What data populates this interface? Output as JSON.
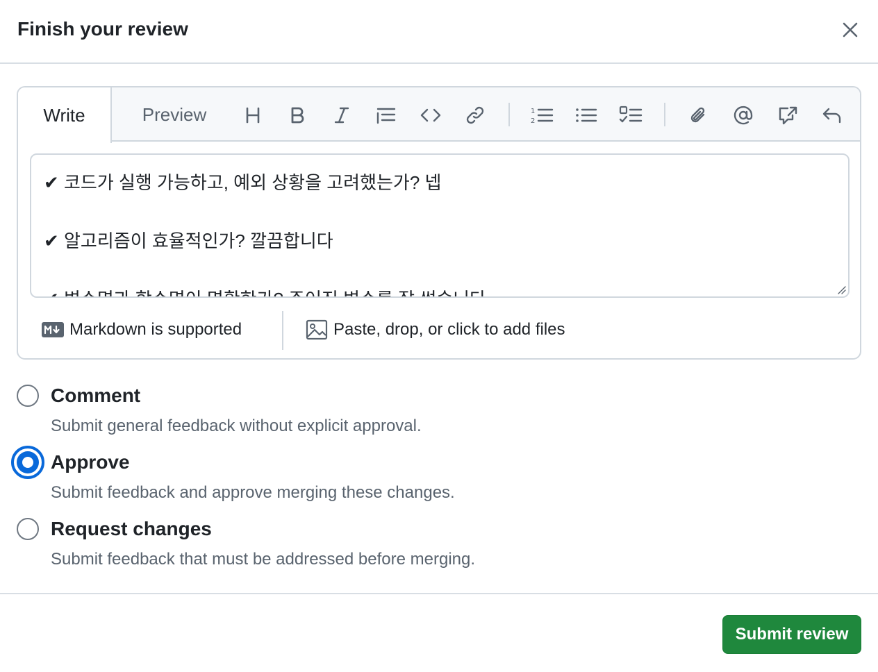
{
  "dialog": {
    "title": "Finish your review"
  },
  "editor": {
    "tabs": [
      {
        "label": "Write",
        "active": true
      },
      {
        "label": "Preview",
        "active": false
      }
    ],
    "toolbar_icons": [
      "heading-icon",
      "bold-icon",
      "italic-icon",
      "quote-icon",
      "code-icon",
      "link-icon",
      "numbered-list-icon",
      "unordered-list-icon",
      "task-list-icon",
      "attach-icon",
      "mention-icon",
      "cross-reference-icon",
      "reply-icon"
    ],
    "lines": [
      "✔ 코드가 실행 가능하고, 예외 상황을 고려했는가? 넵",
      "✔ 알고리즘이 효율적인가? 깔끔합니다",
      "✔ 변수명과 함수명이 명확한가? 주어진 변수를 잘 썼습니다"
    ],
    "markdown_note": "Markdown is supported",
    "files_note": "Paste, drop, or click to add files"
  },
  "options": [
    {
      "label": "Comment",
      "description": "Submit general feedback without explicit approval.",
      "checked": false
    },
    {
      "label": "Approve",
      "description": "Submit feedback and approve merging these changes.",
      "checked": true
    },
    {
      "label": "Request changes",
      "description": "Submit feedback that must be addressed before merging.",
      "checked": false
    }
  ],
  "submit": {
    "label": "Submit review"
  },
  "colors": {
    "accent": "#0969da",
    "submit_green": "#1f883d",
    "border": "#d0d7de",
    "muted_text": "#59636e"
  }
}
